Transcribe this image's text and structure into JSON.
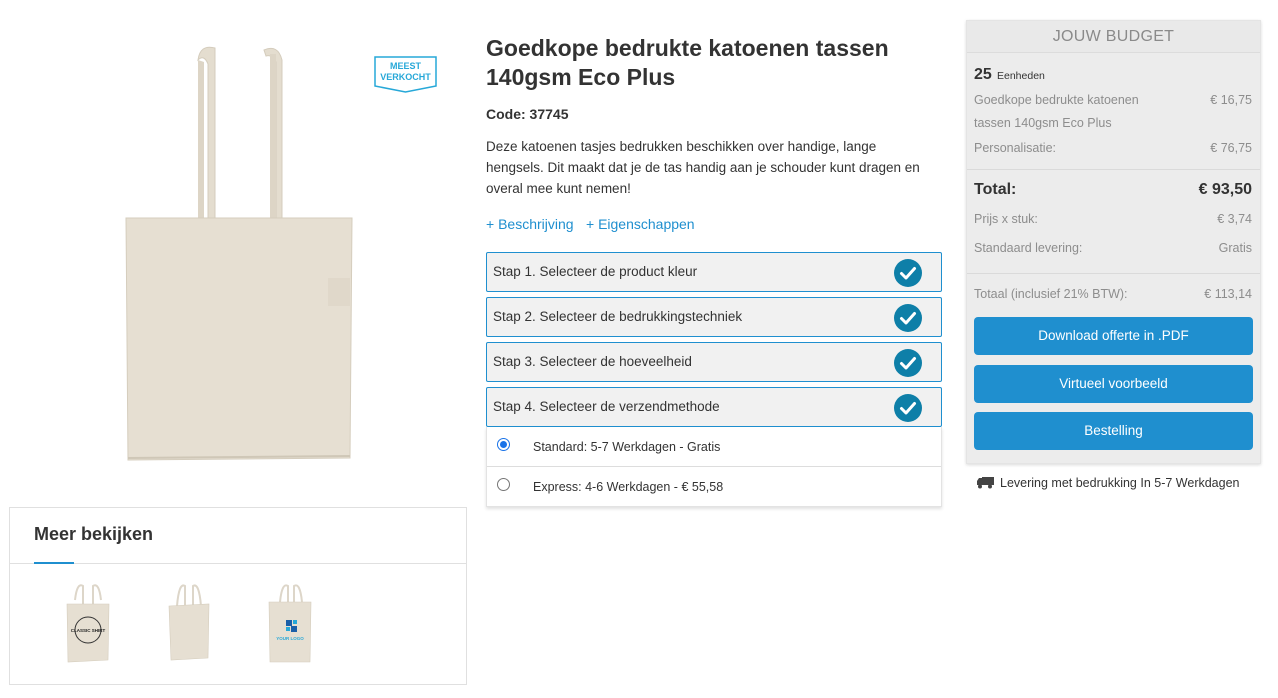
{
  "product": {
    "title": "Goedkope bedrukte katoenen tassen 140gsm Eco Plus",
    "code": "Code: 37745",
    "description": "Deze katoenen tasjes bedrukken beschikken over handige, lange hengsels. Dit maakt dat je de tas handig aan je schouder kunt dragen en overal mee kunt nemen!",
    "badge_line1": "MEEST",
    "badge_line2": "VERKOCHT"
  },
  "links": {
    "description": "+ Beschrijving",
    "properties": "+ Eigenschappen"
  },
  "steps": [
    {
      "label": "Stap 1. Selecteer de product kleur",
      "done": true
    },
    {
      "label": "Stap 2. Selecteer de bedrukkingstechniek",
      "done": true
    },
    {
      "label": "Stap 3. Selecteer de hoeveelheid",
      "done": true
    },
    {
      "label": "Stap 4. Selecteer de verzendmethode",
      "done": true
    }
  ],
  "shipping": [
    {
      "label": "Standard: 5-7 Werkdagen - Gratis",
      "selected": true
    },
    {
      "label": "Express: 4-6 Werkdagen - € 55,58",
      "selected": false
    }
  ],
  "more": {
    "title": "Meer bekijken",
    "thumb1_text_top": "CLASSIC SHIRT",
    "thumb3_text": "YOUR LOGO"
  },
  "budget": {
    "header": "JOUW BUDGET",
    "quantity": "25",
    "quantity_unit": "Eenheden",
    "product_line1": "Goedkope bedrukte katoenen",
    "product_line2": "tassen 140gsm Eco Plus",
    "product_price": "€ 16,75",
    "personalisation_label": "Personalisatie:",
    "personalisation_price": "€ 76,75",
    "total_label": "Total:",
    "total_value": "€ 93,50",
    "unit_label": "Prijs x stuk:",
    "unit_value": "€ 3,74",
    "delivery_label": "Standaard levering:",
    "delivery_value": "Gratis",
    "vat_label": "Totaal (inclusief 21% BTW):",
    "vat_value": "€ 113,14",
    "buttons": [
      "Download offerte in .PDF",
      "Virtueel voorbeeld",
      "Bestelling"
    ]
  },
  "delivery_note": "Levering met bedrukking In 5-7 Werkdagen",
  "colors": {
    "accent": "#1f8fcf",
    "check": "#0e7fa8",
    "bag": "#e6dfd2"
  }
}
